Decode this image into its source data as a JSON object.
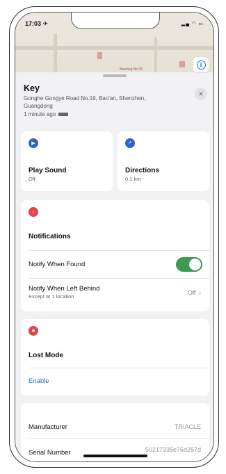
{
  "status_bar": {
    "time": "17:03 ✈",
    "icons": "▂▄ ◠ ▭"
  },
  "map": {
    "label": "Baolong No.25"
  },
  "item": {
    "name": "Key",
    "address": "Gonghe Gongye Road No.19, Bao'an, Shenzhen, Guangdong",
    "updated": "1 minute ago"
  },
  "actions": {
    "play_sound": {
      "title": "Play Sound",
      "status": "Off"
    },
    "directions": {
      "title": "Directions",
      "distance": "0.1 km"
    }
  },
  "notifications": {
    "title": "Notifications",
    "notify_found": {
      "label": "Notify When Found",
      "enabled": true
    },
    "notify_left_behind": {
      "label": "Notify When Left Behind",
      "sub": "Except at 1 location",
      "value": "Off"
    }
  },
  "lost_mode": {
    "title": "Lost Mode",
    "action": "Enable"
  },
  "details": {
    "manufacturer": {
      "label": "Manufacturer",
      "value": "TRIACLE"
    },
    "serial_number": {
      "label": "Serial Number",
      "value": "50217335e76d257d"
    }
  },
  "colors": {
    "accent_blue": "#2b6bd6",
    "toggle_green": "#3b9b55",
    "alert_red": "#e0454c"
  }
}
